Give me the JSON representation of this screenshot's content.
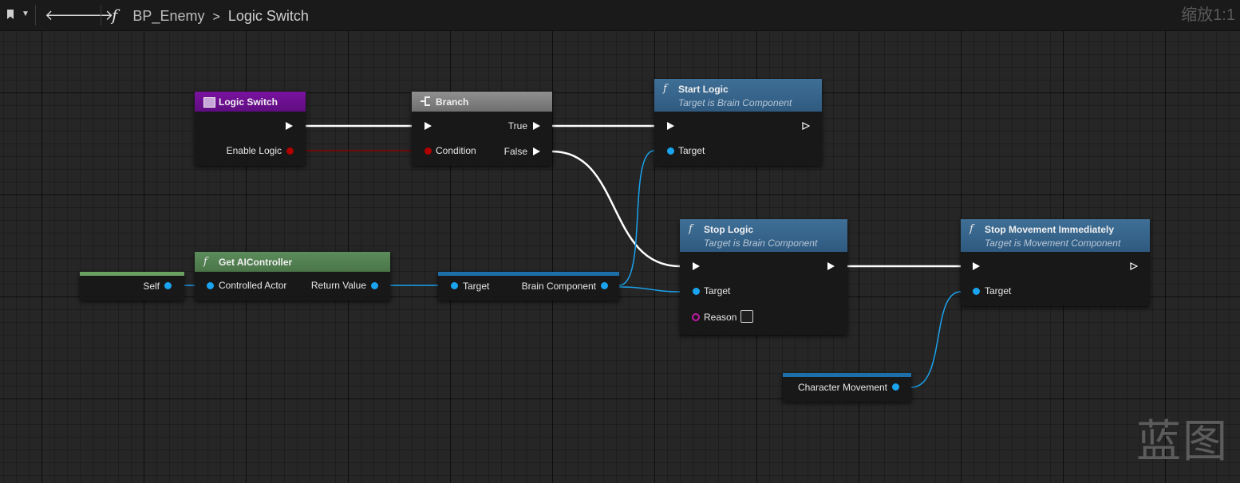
{
  "toolbar": {
    "breadcrumb_blueprint": "BP_Enemy",
    "breadcrumb_separator": ">",
    "breadcrumb_function": "Logic Switch",
    "zoom_label": "缩放1:1",
    "icons": [
      "bookmark-icon",
      "chevron-down-icon",
      "back-arrow-icon",
      "forward-arrow-icon",
      "function-icon"
    ]
  },
  "nodes": {
    "logic_switch": {
      "title": "Logic Switch",
      "pin_enable": "Enable Logic",
      "color": "#7a12a0"
    },
    "branch": {
      "title": "Branch",
      "pin_condition": "Condition",
      "pin_true": "True",
      "pin_false": "False"
    },
    "start_logic": {
      "title": "Start Logic",
      "subtitle": "Target is Brain Component",
      "pin_target": "Target"
    },
    "stop_logic": {
      "title": "Stop Logic",
      "subtitle": "Target is Brain Component",
      "pin_target": "Target",
      "pin_reason": "Reason"
    },
    "stop_movement": {
      "title": "Stop Movement Immediately",
      "subtitle": "Target is Movement Component",
      "pin_target": "Target"
    },
    "self_node": {
      "pin_self": "Self"
    },
    "get_ai_controller": {
      "title": "Get AIController",
      "pin_controlled_actor": "Controlled Actor",
      "pin_return": "Return Value"
    },
    "brain_component": {
      "pin_target": "Target",
      "pin_brain": "Brain Component"
    },
    "character_movement": {
      "pin_label": "Character Movement"
    }
  },
  "colors": {
    "exec_wire": "#ffffff",
    "object_wire": "#1aa3ee",
    "bool_wire": "#8a0000",
    "background": "#262626"
  },
  "watermark": "蓝图"
}
